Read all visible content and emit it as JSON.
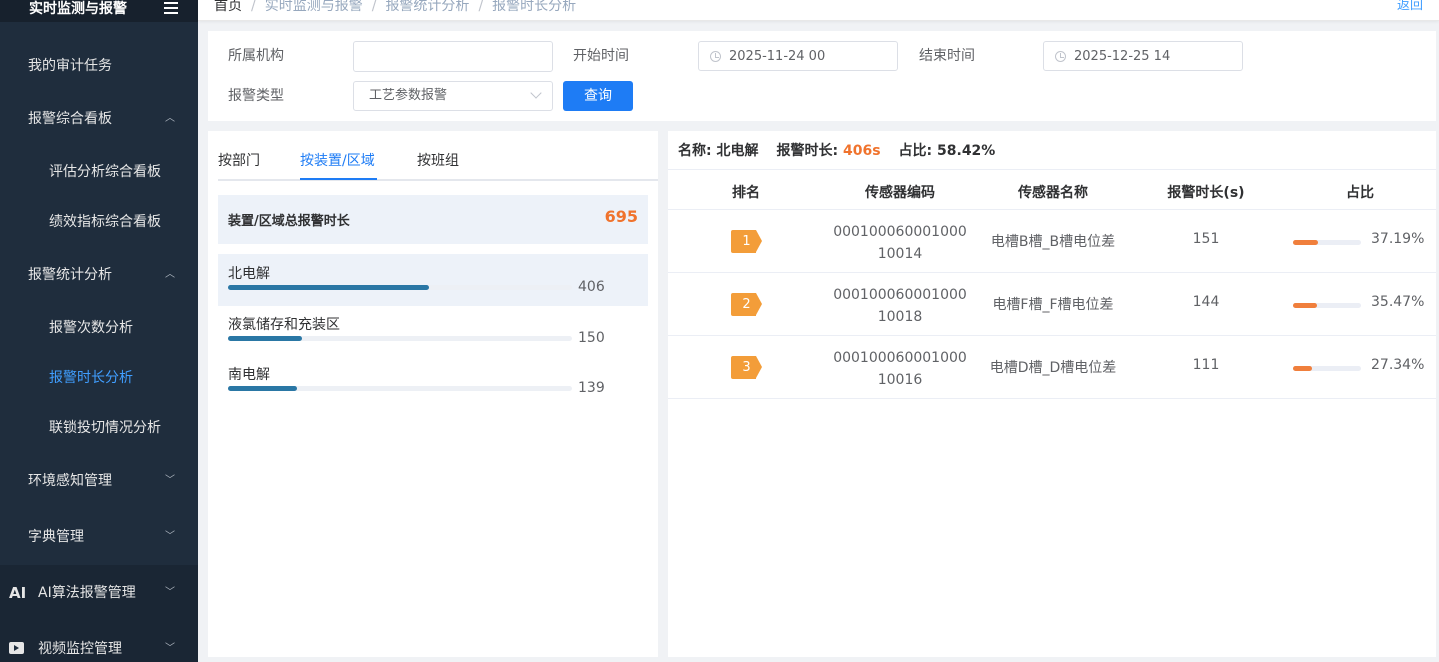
{
  "sidebar": {
    "title": "实时监测与报警",
    "items": [
      {
        "label": "我的审计任务"
      },
      {
        "label": "报警综合看板"
      },
      {
        "label": "评估分析综合看板"
      },
      {
        "label": "绩效指标综合看板"
      },
      {
        "label": "报警统计分析"
      },
      {
        "label": "报警次数分析"
      },
      {
        "label": "报警时长分析"
      },
      {
        "label": "联锁投切情况分析"
      },
      {
        "label": "环境感知管理"
      },
      {
        "label": "字典管理"
      },
      {
        "label": "AI算法报警管理"
      },
      {
        "label": "视频监控管理"
      }
    ],
    "ai_icon_text": "AI"
  },
  "breadcrumb": {
    "items": [
      "首页",
      "实时监测与报警",
      "报警统计分析",
      "报警时长分析"
    ],
    "separator": "/",
    "back": "返回"
  },
  "filter": {
    "org_label": "所属机构",
    "org_value": "",
    "start_label": "开始时间",
    "start_value": "2025-11-24 00",
    "end_label": "结束时间",
    "end_value": "2025-12-25 14",
    "type_label": "报警类型",
    "type_value": "工艺参数报警",
    "query_button": "查询"
  },
  "left": {
    "tabs": [
      {
        "label": "按部门"
      },
      {
        "label": "按装置/区域"
      },
      {
        "label": "按班组"
      }
    ],
    "total_label": "装置/区域总报警时长",
    "total_value": "695",
    "ranking": [
      {
        "name": "北电解",
        "value": "406",
        "fraction": 0.5842
      },
      {
        "name": "液氯储存和充装区",
        "value": "150",
        "fraction": 0.2158
      },
      {
        "name": "南电解",
        "value": "139",
        "fraction": 0.2
      }
    ]
  },
  "right": {
    "name_label": "名称:",
    "name_value": "北电解",
    "duration_label": "报警时长:",
    "duration_value": "406s",
    "ratio_label": "占比:",
    "ratio_value": "58.42%",
    "columns": [
      "排名",
      "传感器编码",
      "传感器名称",
      "报警时长(s)",
      "占比"
    ],
    "rows": [
      {
        "rank": "1",
        "code": "00010006000100010014",
        "name": "电槽B槽_B槽电位差",
        "duration": "151",
        "percent": "37.19%",
        "fraction": 0.3719
      },
      {
        "rank": "2",
        "code": "00010006000100010018",
        "name": "电槽F槽_F槽电位差",
        "duration": "144",
        "percent": "35.47%",
        "fraction": 0.3547
      },
      {
        "rank": "3",
        "code": "00010006000100010016",
        "name": "电槽D槽_D槽电位差",
        "duration": "111",
        "percent": "27.34%",
        "fraction": 0.2734
      }
    ]
  },
  "colors": {
    "sidebar_bg": "#1f2d3d",
    "accent": "#1e7cf5",
    "highlight": "#f0732d",
    "bar": "#2a77a5",
    "badge": "#f39d39"
  }
}
